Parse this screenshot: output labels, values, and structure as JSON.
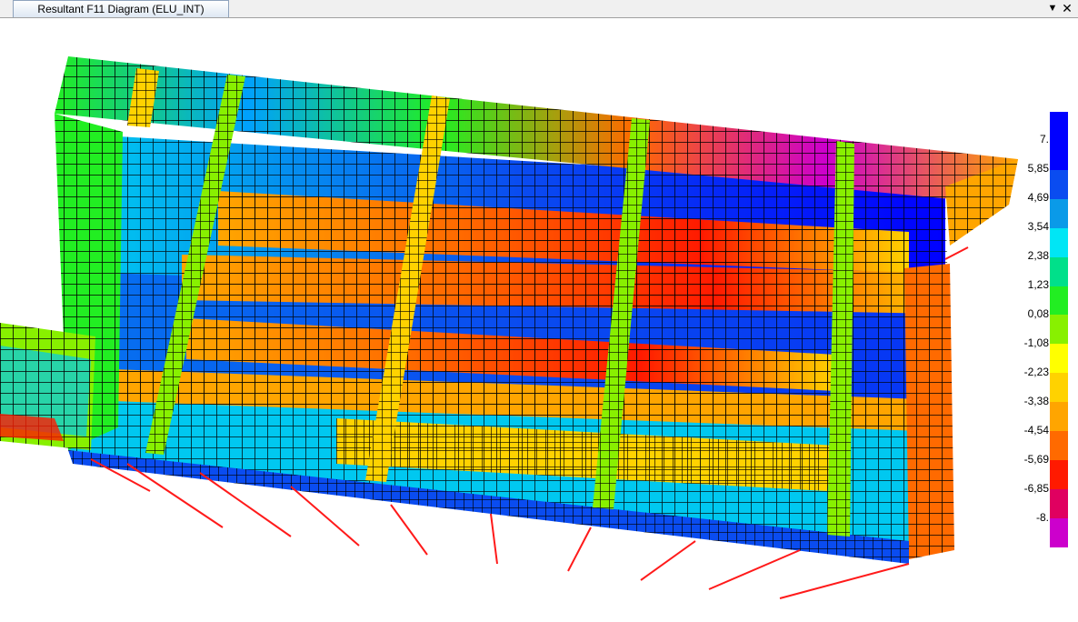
{
  "tab": {
    "title": "Resultant F11 Diagram (ELU_INT)"
  },
  "window_controls": {
    "dropdown_icon": "chevron-down-icon",
    "close_icon": "close-icon"
  },
  "legend": {
    "labels": [
      "7.",
      "5,85",
      "4,69",
      "3,54",
      "2,38",
      "1,23",
      "0,08",
      "-1,08",
      "-2,23",
      "-3,38",
      "-4,54",
      "-5,69",
      "-6,85",
      "-8."
    ],
    "colors": [
      "#0000ff",
      "#0a4cf0",
      "#0a9ae8",
      "#00e6f5",
      "#00e08a",
      "#22ee22",
      "#88f000",
      "#ffff00",
      "#ffd200",
      "#ffa500",
      "#ff6a00",
      "#ff1a00",
      "#e00060",
      "#cc00cc"
    ]
  }
}
